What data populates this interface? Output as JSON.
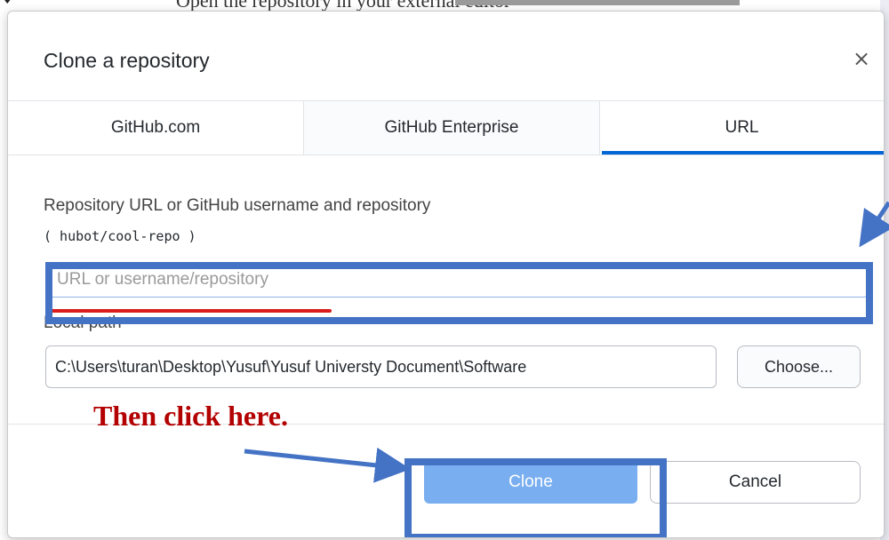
{
  "background": {
    "partial_text": "Open the repository in your external editor"
  },
  "dialog": {
    "title": "Clone a repository",
    "close_glyph": "×",
    "tabs": [
      {
        "label": "GitHub.com",
        "selected": false
      },
      {
        "label": "GitHub Enterprise",
        "selected": false
      },
      {
        "label": "URL",
        "selected": true
      }
    ],
    "repo_label": "Repository URL or GitHub username and repository",
    "repo_hint": "( hubot/cool-repo )",
    "url_input": {
      "value": "",
      "placeholder": "URL or username/repository"
    },
    "local_path_label": "Local path",
    "local_path_value": "C:\\Users\\turan\\Desktop\\Yusuf\\Yusuf Universty Document\\Software",
    "choose_label": "Choose...",
    "clone_label": "Clone",
    "cancel_label": "Cancel"
  },
  "annotation": {
    "text": "Then click here.",
    "box_color": "#4472c4",
    "text_color": "#b30000",
    "underline_color": "#dc1c1c"
  },
  "colors": {
    "accent": "#0366d6",
    "primary_button": "#79aef0"
  }
}
